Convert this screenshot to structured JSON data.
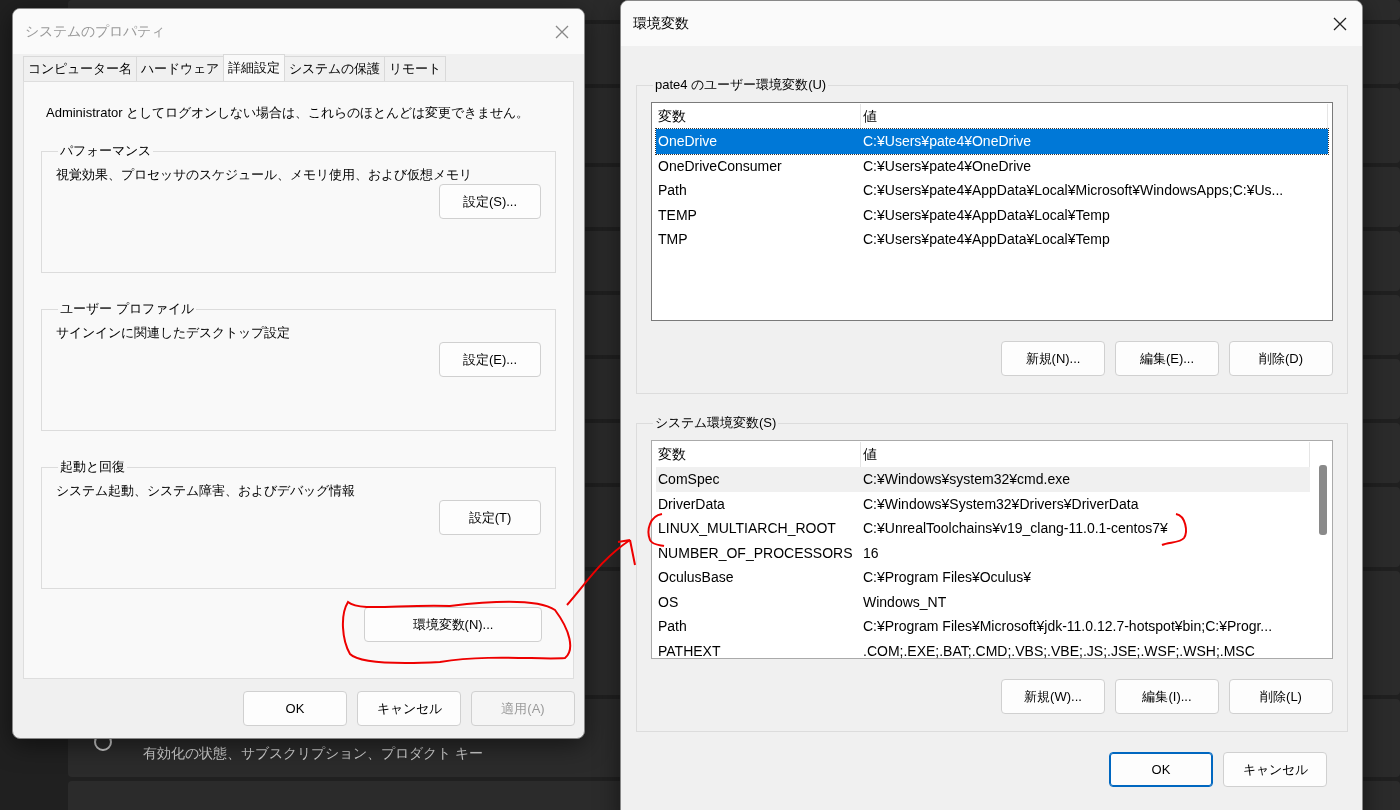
{
  "background": {
    "items": [
      {
        "subtitle": "有効化の状態、サブスクリプション、プロダクト キー"
      }
    ]
  },
  "system_properties": {
    "title": "システムのプロパティ",
    "tabs": [
      {
        "label": "コンピューター名",
        "selected": false
      },
      {
        "label": "ハードウェア",
        "selected": false
      },
      {
        "label": "詳細設定",
        "selected": true
      },
      {
        "label": "システムの保護",
        "selected": false
      },
      {
        "label": "リモート",
        "selected": false
      }
    ],
    "notice": "Administrator としてログオンしない場合は、これらのほとんどは変更できません。",
    "groups": [
      {
        "title": "パフォーマンス",
        "description": "視覚効果、プロセッサのスケジュール、メモリ使用、および仮想メモリ",
        "button": "設定(S)..."
      },
      {
        "title": "ユーザー プロファイル",
        "description": "サインインに関連したデスクトップ設定",
        "button": "設定(E)..."
      },
      {
        "title": "起動と回復",
        "description": "システム起動、システム障害、およびデバッグ情報",
        "button": "設定(T)"
      }
    ],
    "env_button": "環境変数(N)...",
    "buttons": [
      {
        "label": "OK",
        "disabled": false
      },
      {
        "label": "キャンセル",
        "disabled": false
      },
      {
        "label": "適用(A)",
        "disabled": true
      }
    ]
  },
  "env_dialog": {
    "title": "環境変数",
    "sections": [
      {
        "title": "pate4 のユーザー環境変数(U)",
        "focused": true,
        "columns": [
          "変数",
          "値"
        ],
        "rows": [
          {
            "name": "OneDrive",
            "value": "C:¥Users¥pate4¥OneDrive",
            "selected": true
          },
          {
            "name": "OneDriveConsumer",
            "value": "C:¥Users¥pate4¥OneDrive",
            "selected": false
          },
          {
            "name": "Path",
            "value": "C:¥Users¥pate4¥AppData¥Local¥Microsoft¥WindowsApps;C:¥Us...",
            "selected": false
          },
          {
            "name": "TEMP",
            "value": "C:¥Users¥pate4¥AppData¥Local¥Temp",
            "selected": false
          },
          {
            "name": "TMP",
            "value": "C:¥Users¥pate4¥AppData¥Local¥Temp",
            "selected": false
          }
        ],
        "buttons": [
          "新規(N)...",
          "編集(E)...",
          "削除(D)"
        ]
      },
      {
        "title": "システム環境変数(S)",
        "focused": false,
        "columns": [
          "変数",
          "値"
        ],
        "rows": [
          {
            "name": "ComSpec",
            "value": "C:¥Windows¥system32¥cmd.exe",
            "selected": true
          },
          {
            "name": "DriverData",
            "value": "C:¥Windows¥System32¥Drivers¥DriverData",
            "selected": false
          },
          {
            "name": "LINUX_MULTIARCH_ROOT",
            "value": "C:¥UnrealToolchains¥v19_clang-11.0.1-centos7¥",
            "selected": false
          },
          {
            "name": "NUMBER_OF_PROCESSORS",
            "value": "16",
            "selected": false
          },
          {
            "name": "OculusBase",
            "value": "C:¥Program Files¥Oculus¥",
            "selected": false
          },
          {
            "name": "OS",
            "value": "Windows_NT",
            "selected": false
          },
          {
            "name": "Path",
            "value": "C:¥Program Files¥Microsoft¥jdk-11.0.12.7-hotspot¥bin;C:¥Progr...",
            "selected": false
          },
          {
            "name": "PATHEXT",
            "value": ".COM;.EXE;.BAT;.CMD;.VBS;.VBE;.JS;.JSE;.WSF;.WSH;.MSC",
            "selected": false
          }
        ],
        "buttons": [
          "新規(W)...",
          "編集(I)...",
          "削除(L)"
        ]
      }
    ],
    "buttons": [
      {
        "label": "OK",
        "default": true
      },
      {
        "label": "キャンセル",
        "default": false
      }
    ]
  }
}
